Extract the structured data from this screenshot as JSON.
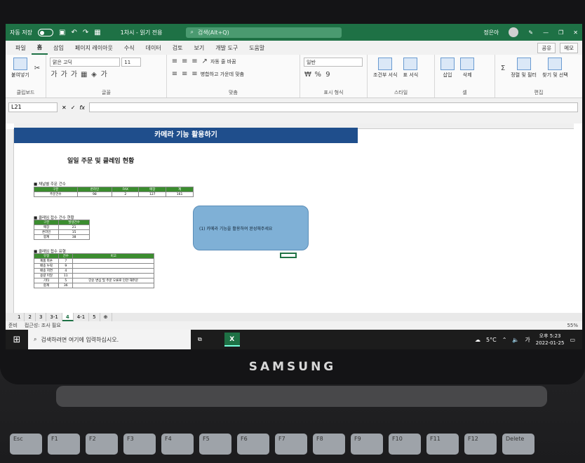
{
  "title_bar": {
    "autosave_label": "자동 저장",
    "doc_title": "1차시 - 읽기 전용",
    "search_placeholder": "검색(Alt+Q)",
    "user_name": "정은아"
  },
  "menu": {
    "tabs": [
      "파일",
      "홈",
      "삽입",
      "페이지 레이아웃",
      "수식",
      "데이터",
      "검토",
      "보기",
      "개발 도구",
      "도움말"
    ],
    "active_tab": "홈",
    "share_label": "공유",
    "memo_label": "메모"
  },
  "ribbon": {
    "clipboard": {
      "label": "클립보드",
      "paste_label": "붙여넣기"
    },
    "font": {
      "label": "글꼴",
      "font_name": "맑은 고딕",
      "font_size": "11"
    },
    "alignment": {
      "label": "맞춤",
      "wrap_label": "자동 줄 바꿈",
      "merge_label": "병합하고 가운데 맞춤"
    },
    "number": {
      "label": "표시 형식",
      "format": "일반"
    },
    "styles": {
      "label": "스타일",
      "conditional_label": "조건부 서식",
      "table_label": "표 서식",
      "cell_style_label": "셀 스타일"
    },
    "cells": {
      "label": "셀",
      "insert_label": "삽입",
      "delete_label": "삭제",
      "format_label": "서식"
    },
    "editing": {
      "label": "편집",
      "sort_label": "정렬 및 필터",
      "find_label": "찾기 및 선택"
    }
  },
  "formula_bar": {
    "name_box": "L21",
    "formula": ""
  },
  "sheet": {
    "title": "카메라 기능 활용하기",
    "subtitle": "일일 주문 및 클레임 현황",
    "section1": "■ 채널별 주문 건수",
    "table1": {
      "headers": [
        "구분",
        "온라인",
        "FAX",
        "매장",
        "계"
      ],
      "rows": [
        [
          "주문건수",
          "98",
          "2",
          "127",
          "161"
        ]
      ]
    },
    "section2": "■ 클레임 접수 건수 현황",
    "table2": {
      "headers": [
        "구분",
        "발생건수"
      ],
      "rows": [
        [
          "매장",
          "21"
        ],
        [
          "온라인",
          "15"
        ],
        [
          "합계",
          "38"
        ]
      ]
    },
    "section3": "■ 클레임 접수 유형",
    "table3": {
      "headers": [
        "유형",
        "건수",
        "비고"
      ],
      "rows": [
        [
          "제품 파손",
          "7",
          ""
        ],
        [
          "배송 누락",
          "9",
          ""
        ],
        [
          "배송 지연",
          "4",
          ""
        ],
        [
          "용량 미달",
          "11",
          ""
        ],
        [
          "기타",
          "5",
          "단순 변심 및 주문 오류로 인한 재주문"
        ],
        [
          "합계",
          "36",
          ""
        ]
      ]
    },
    "instruction": "(1) 카메라 기능을 활용하여 완성해주세요"
  },
  "sheet_tabs": [
    "1",
    "2",
    "3",
    "3-1",
    "4",
    "4-1",
    "5"
  ],
  "active_sheet": "4",
  "status": {
    "ready": "준비",
    "accessibility": "접근성: 조사 필요",
    "zoom": "55%"
  },
  "taskbar": {
    "search_placeholder": "검색하려면 여기에 입력하십시오.",
    "temperature": "5°C",
    "time": "오후 5:23",
    "date": "2022-01-25",
    "ime": "가"
  },
  "brand": "SAMSUNG",
  "keys": [
    "Esc",
    "F1",
    "F2",
    "F3",
    "F4",
    "F5",
    "F6",
    "F7",
    "F8",
    "F9",
    "F10",
    "F11",
    "F12",
    "Delete"
  ],
  "colors": {
    "excel_green": "#1e7145",
    "header_blue": "#1f4e8c",
    "table_green": "#3b8d2f",
    "callout_blue": "#7fb0d6"
  }
}
